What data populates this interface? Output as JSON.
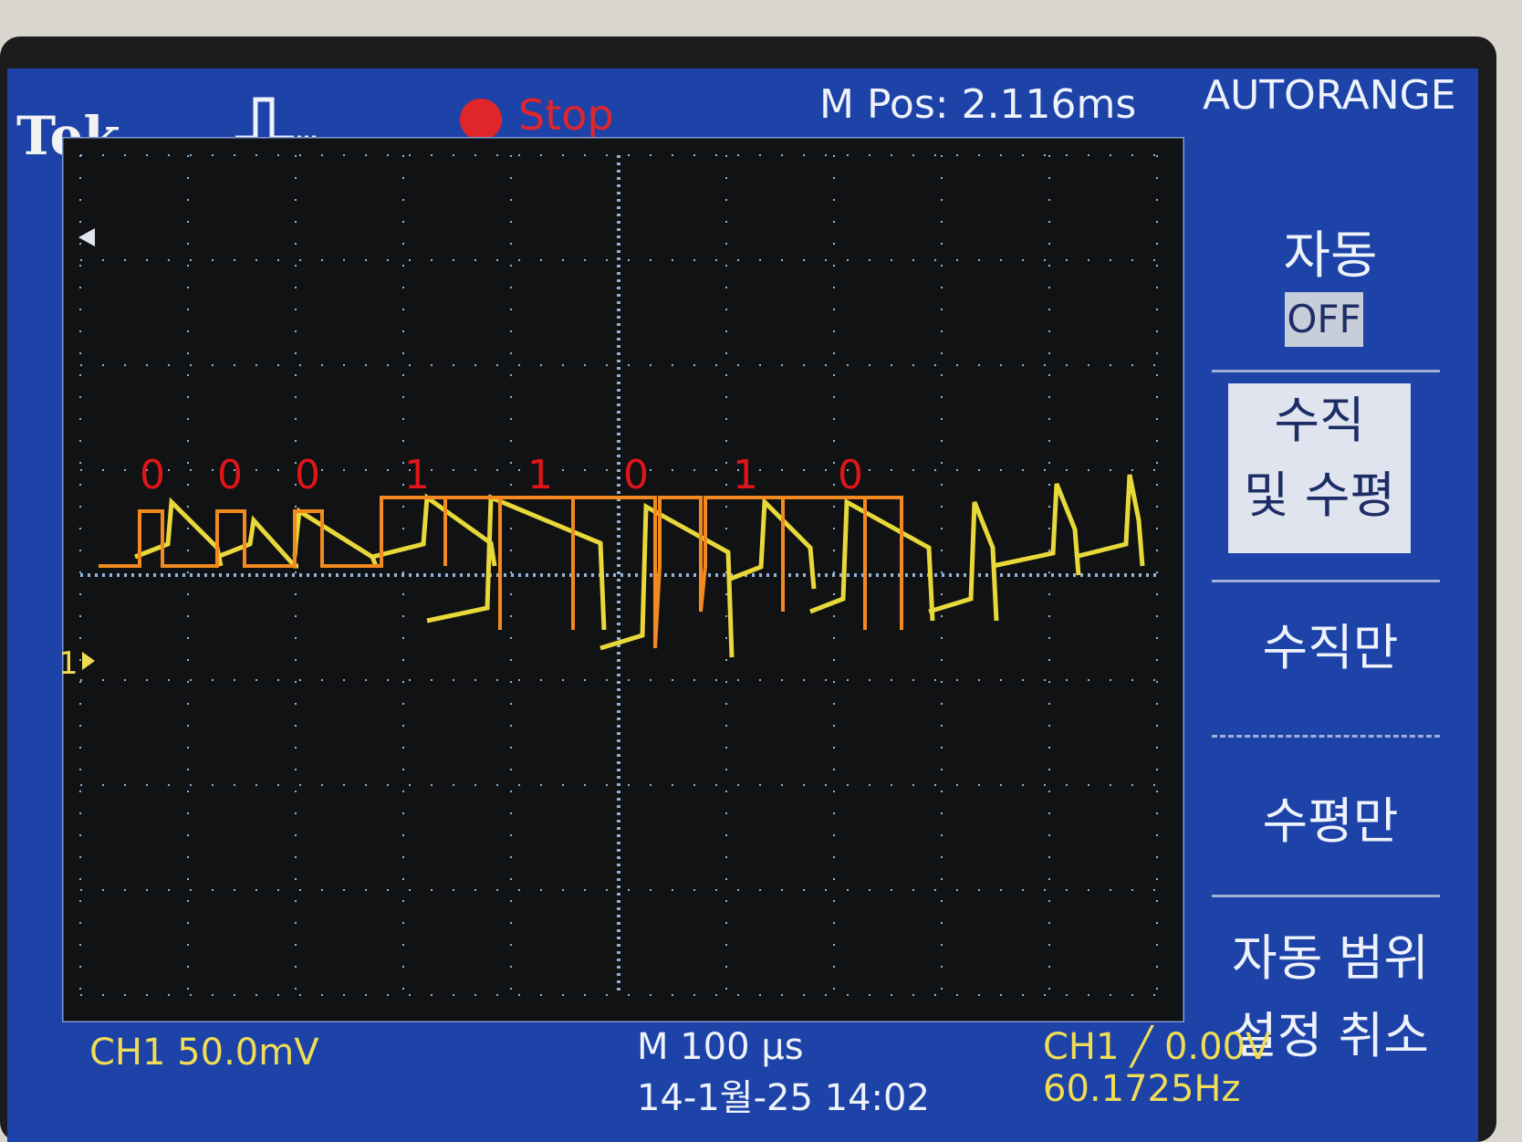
{
  "header": {
    "brand": "Tek",
    "run_state": "Stop",
    "position": "M Pos: 2.116ms",
    "menu_title": "AUTORANGE"
  },
  "menu": {
    "auto_label": "자동",
    "auto_state": "OFF",
    "vertical_horizontal_line1": "수직",
    "vertical_horizontal_line2": "및 수평",
    "vertical_only": "수직만",
    "horizontal_only": "수평만",
    "undo_line1": "자동 범위",
    "undo_line2": "설정 취소"
  },
  "footer": {
    "ch1_scale": "CH1  50.0mV",
    "timebase": "M 100 µs",
    "datetime": "14-1월-25 14:02",
    "trigger": "CH1 ╱ 0.00V",
    "frequency": "60.1725Hz"
  },
  "annotations": {
    "bits": [
      "0",
      "0",
      "0",
      "1",
      "1",
      "0",
      "1",
      "0"
    ],
    "bit_color": "#e0151a",
    "overlay_color": "#f28a1f"
  },
  "waveform": {
    "trace_color": "#e8d83a",
    "channel_marker": "1"
  }
}
